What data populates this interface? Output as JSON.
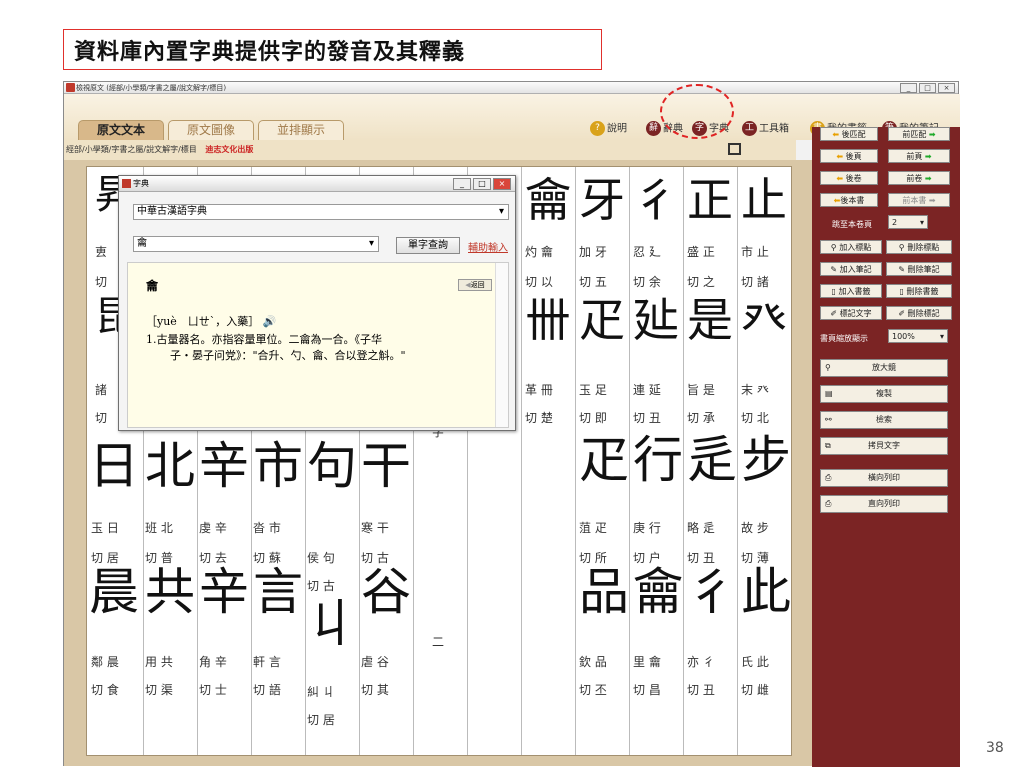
{
  "slide": {
    "title": "資料庫內置字典提供字的發音及其釋義",
    "page_number": "38"
  },
  "window": {
    "title": "檢視原文 (經部/小學類/字書之屬/說文解字/標目)",
    "tabs": [
      "原文文本",
      "原文圖像",
      "並排顯示"
    ],
    "toolbar": {
      "help": "說明",
      "cidian": "辭典",
      "zidian": "字典",
      "tools": "工具箱",
      "bookmarks": "我的書籤",
      "notes": "我的筆記"
    },
    "breadcrumb": "經部/小學類/字書之屬/說文解字/標目",
    "publisher": "迪志文化出版"
  },
  "right_panel": {
    "prev_match": "後匹配",
    "next_match": "前匹配",
    "prev_page": "後頁",
    "next_page": "前頁",
    "prev_vol": "後卷",
    "next_vol": "前卷",
    "prev_book": "後本書",
    "next_book": "前本書",
    "jump_label": "跳至本卷頁",
    "jump_value": "2",
    "add_mark": "加入標點",
    "del_mark": "刪除標點",
    "add_note": "加入筆記",
    "del_note": "刪除筆記",
    "add_bm": "加入書籤",
    "del_bm": "刪除書籤",
    "mark_text": "標記文字",
    "del_mark_text": "刪除標記",
    "zoom_label": "書頁縮放顯示",
    "zoom_value": "100%",
    "magnifier": "放大鏡",
    "copy": "複製",
    "search": "檢索",
    "copy_text": "拷貝文字",
    "print_h": "橫向列印",
    "print_v": "直向列印"
  },
  "dictionary": {
    "title": "字典",
    "selected": "中華古漢語字典",
    "input": "龠",
    "lookup": "單字查詢",
    "assist": "輔助輸入",
    "headword": "龠",
    "back": "返回",
    "pron": "［yuè　ㄩㄝˋ，入藥］",
    "def1": "1.古量器名。亦指容量單位。二龠為一合。《子华",
    "def2": "子・晏子问党》：\"合升、勺、龠、合以登之斛。\""
  },
  "columns": [
    {
      "seal": "亠",
      "a": "叀",
      "b": "切",
      "c": "",
      "d": "",
      "glyph1": "",
      "glyph2": "",
      "e": "",
      "f": ""
    },
    {
      "seal": "",
      "a": "",
      "b": "",
      "c": "諸",
      "d": "切",
      "glyph1": "",
      "glyph2": "",
      "e": "",
      "f": ""
    },
    {
      "seal": "龠",
      "a": "灼 龠",
      "b": "切 以",
      "c": "革 冊",
      "d": "切 楚",
      "glyph1": "",
      "glyph2": "",
      "e": "",
      "f": ""
    },
    {
      "seal": "牙",
      "a": "加 牙",
      "b": "切 五",
      "c": "玉 足",
      "d": "切 即",
      "glyph1": "疋",
      "glyph2": "品",
      "e": "菹 疋",
      "f": "切 所"
    },
    {
      "seal": "彳",
      "a": "忍 廴",
      "b": "切 余",
      "c": "連 延",
      "d": "切 丑",
      "glyph1": "行",
      "glyph2": "龠",
      "e": "庚 行",
      "f": "切 户"
    },
    {
      "seal": "正",
      "a": "盛 正",
      "b": "切 之",
      "c": "旨 是",
      "d": "切 承",
      "glyph1": "辵",
      "glyph2": "彳",
      "e": "略 辵",
      "f": "切 丑"
    },
    {
      "seal": "止",
      "a": "市 止",
      "b": "切 諸",
      "c": "末 癶",
      "d": "切 北",
      "glyph1": "步",
      "glyph2": "此",
      "e": "故 步",
      "f": "切 薄"
    }
  ],
  "lower": [
    {
      "g": "玉",
      "h": "切",
      "seal": "日",
      "n": "玉 日",
      "m": "切 居",
      "seal2": "晨",
      "n2": "鄰 晨",
      "m2": "切 食"
    },
    {
      "seal": "北",
      "n": "班 北",
      "m": "切 普",
      "seal2": "共",
      "n2": "用 共",
      "m2": "切 渠"
    },
    {
      "seal": "辛",
      "n": "虔 辛",
      "m": "切 去",
      "seal2": "辛",
      "n2": "角 辛",
      "m2": "切 士"
    },
    {
      "seal": "市",
      "n": "沓 市",
      "m": "切 蘇",
      "seal2": "言",
      "n2": "軒 言",
      "m2": "切 語"
    },
    {
      "seal": "句",
      "n": "侯 句",
      "m": "切 古",
      "seal2": "丩",
      "n2": "糾 丩",
      "m2": "切 居"
    },
    {
      "seal": "干",
      "n": "寒 干",
      "m": "切 古",
      "seal2": "谷",
      "n2": "虐 谷",
      "m2": "切 其"
    },
    {
      "seal": "",
      "n": "字",
      "m": "",
      "seal2": "二",
      "n2": "",
      "m2": ""
    }
  ],
  "bottom_right": [
    {
      "seal": "品",
      "n": "欽 品",
      "m": "切 丕"
    },
    {
      "seal": "龠",
      "n": "里 龠",
      "m": "切 昌"
    },
    {
      "seal": "彳",
      "n": "亦 彳",
      "m": "切 丑"
    },
    {
      "seal": "此",
      "n": "氏 此",
      "m": "切 雌"
    }
  ]
}
